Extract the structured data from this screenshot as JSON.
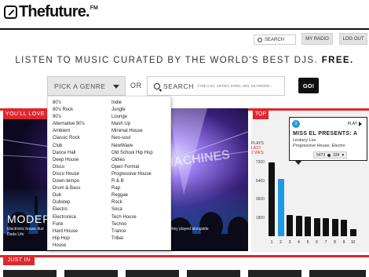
{
  "header": {
    "logo_text": "Thefuture.",
    "logo_fm": "FM",
    "search_label": "SEARCH",
    "my_radio_label": "MY RADIO",
    "logout_label": "LOG OUT"
  },
  "tagline": {
    "text": "LISTEN TO MUSIC CURATED BY THE WORLD'S BEST DJS.",
    "emphasis": "FREE."
  },
  "search": {
    "genre_placeholder": "PICK A GENRE",
    "or_text": "OR",
    "search_label": "SEARCH",
    "search_hint": "TYPE A DJ, ARTIST, SONG, MIX, KEYWORD...",
    "go_label": "GO!"
  },
  "genres": {
    "col1": [
      "80's",
      "80's Rock",
      "90's",
      "Alternative 90's",
      "Ambient",
      "Classic Rock",
      "Club",
      "Dance Hall",
      "Deep House",
      "Disco",
      "Disco House",
      "Down-tempo",
      "Drum & Bass",
      "Dub",
      "Dubstep",
      "Electro",
      "Electronica",
      "Funk",
      "Hard House",
      "Hip Hop",
      "House"
    ],
    "col2": [
      "Indie",
      "Jungle",
      "Lounge",
      "Mash Up",
      "Minimal House",
      "Neo-soul",
      "NewWave",
      "Old School Hip Hop",
      "Oldies",
      "Open Format",
      "Progressive House",
      "R & B",
      "Rap",
      "Reggae",
      "Rock",
      "Soca",
      "Tech House",
      "Techno",
      "Trance",
      "Tribal"
    ]
  },
  "feature": {
    "section_label": "YOU'LL LOVE",
    "title_visible": "MODERN",
    "title_tail": "ES",
    "overlay_text": "MODERN MACHINES",
    "desc_left": "Electronic house duo",
    "desc_right": "festival, where they played alongside",
    "desc_line2": "Dada Life"
  },
  "top": {
    "section_label": "TOP",
    "plays_label": "PLAYS",
    "period_line1": "LAST",
    "period_line2": "2 WKS"
  },
  "tooltip": {
    "rank": "2",
    "play_label": "PLAY",
    "title": "MISS EL PRESENTS: A",
    "artist": "Lindsey Luv",
    "genre": "Progressive House, Electro",
    "plays": "5473",
    "likes": "334"
  },
  "chart_data": {
    "type": "bar",
    "categories": [
      "1",
      "2",
      "3",
      "4",
      "5",
      "6",
      "7",
      "8",
      "9",
      "10"
    ],
    "values": [
      7200,
      5600,
      2100,
      2000,
      1900,
      1800,
      1750,
      1700,
      1650,
      700
    ],
    "highlight_index": 1,
    "ylim": [
      0,
      8000
    ],
    "yticks": [
      1800,
      3600,
      5400,
      7200
    ],
    "title": "",
    "xlabel": "",
    "ylabel": "PLAYS",
    "colors": {
      "bar": "#111111",
      "highlight": "#1e9ae0"
    }
  },
  "just_in": {
    "section_label": "JUST IN"
  },
  "colors": {
    "accent": "#e0262e",
    "highlight": "#1e9ae0"
  }
}
